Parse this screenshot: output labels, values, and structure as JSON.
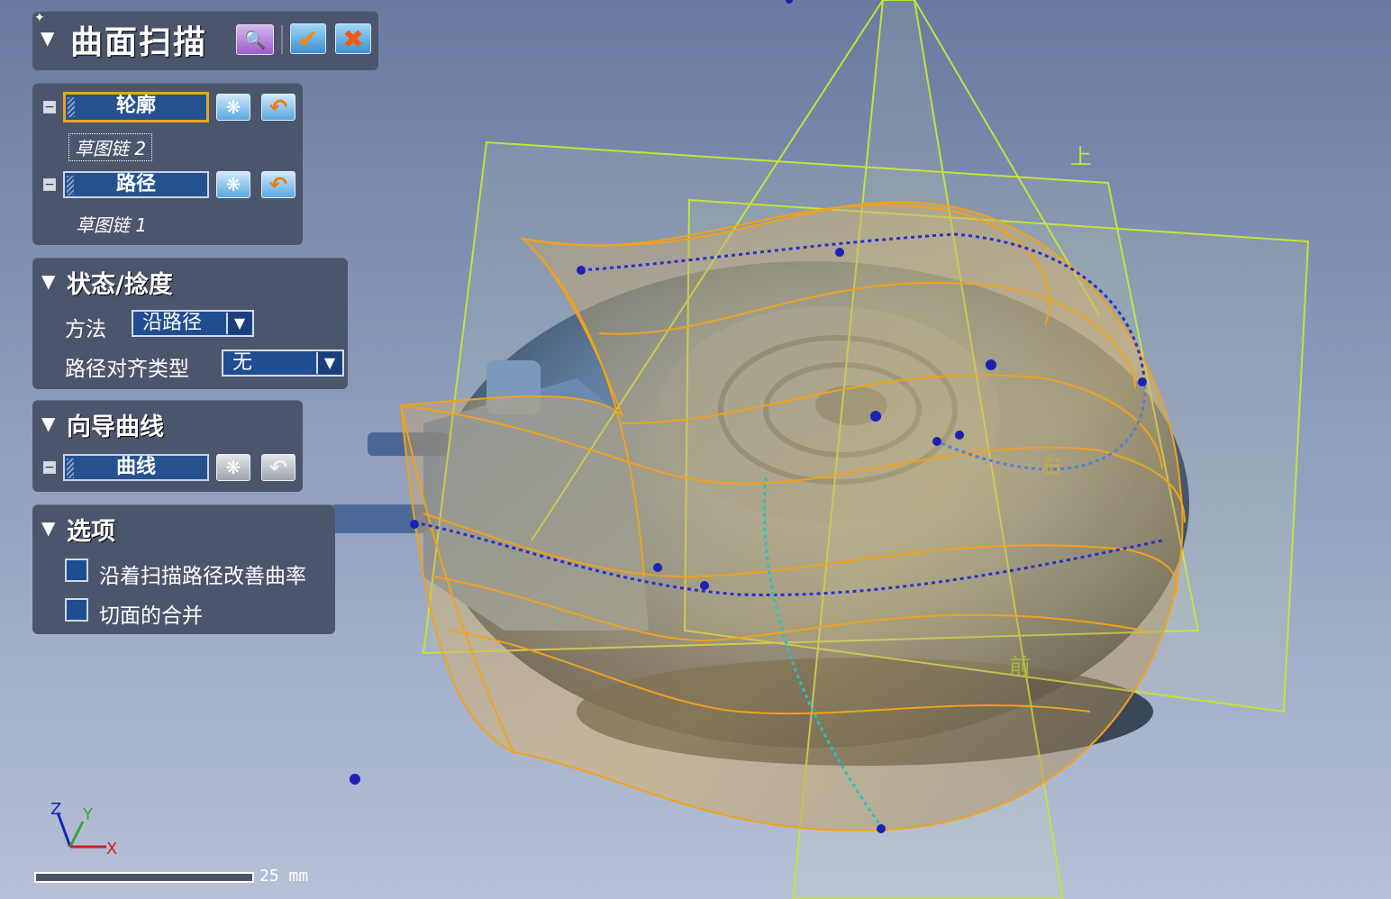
{
  "panel": {
    "title": "曲面扫描",
    "profile": {
      "label": "轮廓",
      "selected": "草图链 2"
    },
    "path": {
      "label": "路径",
      "selected": "草图链 1"
    }
  },
  "state_section": {
    "title": "状态/捻度",
    "method_label": "方法",
    "method_value": "沿路径",
    "align_label": "路径对齐类型",
    "align_value": "无"
  },
  "guide_section": {
    "title": "向导曲线",
    "curve_label": "曲线"
  },
  "options_section": {
    "title": "选项",
    "option1": "沿着扫描路径改善曲率",
    "option2": "切面的合并"
  },
  "viewport": {
    "plane_top": "上",
    "plane_right": "右",
    "plane_front": "前",
    "axis_z": "Z",
    "axis_y": "Y",
    "axis_x": "X",
    "scale_label": "25 mm"
  },
  "colors": {
    "panel_bg": "#4b566c",
    "field_blue": "#25528f",
    "active_border": "#e7a325",
    "plane_line": "#c5e23a",
    "sweep_line": "#f0a21c"
  }
}
